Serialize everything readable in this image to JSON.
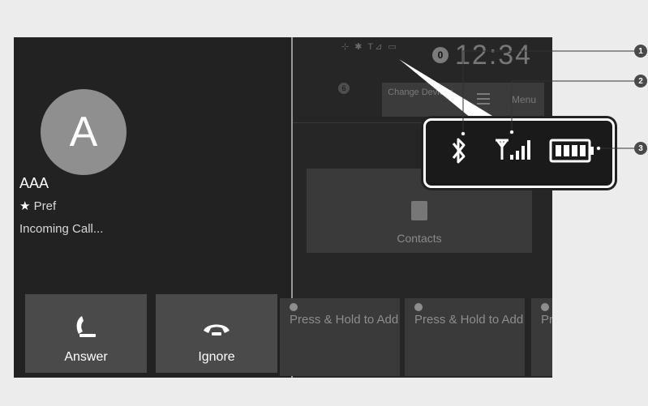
{
  "incoming_call": {
    "avatar_letter": "A",
    "caller_name": "AAA",
    "pref_label": "Pref",
    "status": "Incoming Call...",
    "answer_label": "Answer",
    "ignore_label": "Ignore"
  },
  "phone_home": {
    "status_icons": "⊹ ✱ T⊿ ▭",
    "notification_count": "0",
    "notification_count_small": "6",
    "clock": "12:34",
    "change_devices_label": "Change Devices",
    "menu_label": "Menu",
    "contacts_label": "Contacts",
    "speed_dials": [
      {
        "label": "Press & Hold to Add"
      },
      {
        "label": "Press & Hold to Add"
      },
      {
        "label": "Press & Hold to Add"
      }
    ]
  },
  "callouts": [
    "1",
    "2",
    "3"
  ],
  "colors": {
    "screen_bg": "#222222",
    "button_bg": "#4a4a4a",
    "callout_border": "#ffffff"
  },
  "icons": [
    "bluetooth-icon",
    "signal-strength-icon",
    "battery-icon",
    "phone-answer-icon",
    "phone-hangup-icon",
    "star-icon",
    "contacts-icon",
    "menu-icon"
  ]
}
